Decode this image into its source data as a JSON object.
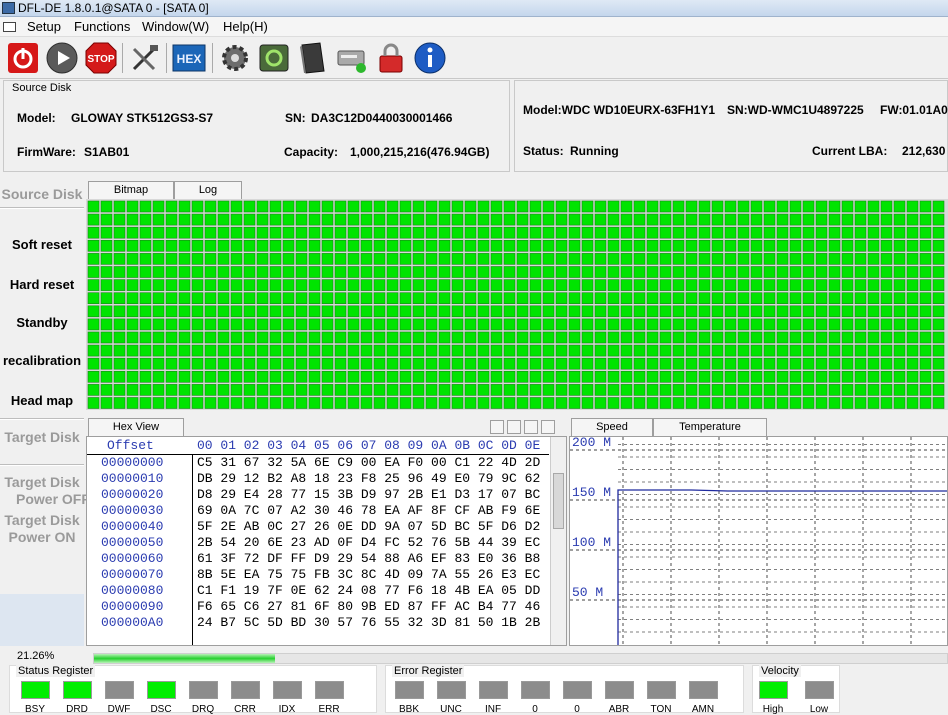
{
  "window": {
    "title": "DFL-DE 1.8.0.1@SATA 0 - [SATA 0]"
  },
  "menu": [
    "Setup",
    "Functions",
    "Window(W)",
    "Help(H)"
  ],
  "toolbar": [
    "power-button",
    "play-button",
    "stop-button",
    "tools-button",
    "hex-button",
    "settings-button",
    "refresh-button",
    "book-button",
    "disk-button",
    "lock-button",
    "info-button"
  ],
  "toolbar_hex_label": "HEX",
  "toolbar_stop_label": "STOP",
  "source": {
    "legend": "Source Disk",
    "model_label": "Model:",
    "model": "GLOWAY STK512GS3-S7",
    "sn_label": "SN:",
    "sn": "DA3C12D0440030001466",
    "firmware_label": "FirmWare:",
    "firmware": "S1AB01",
    "capacity_label": "Capacity:",
    "capacity": "1,000,215,216(476.94GB)"
  },
  "target": {
    "model": "Model:WDC WD10EURX-63FH1Y1",
    "sn": "SN:WD-WMC1U4897225",
    "fw": "FW:01.01A0",
    "status_label": "Status:",
    "status": "Running",
    "lba_label": "Current LBA:",
    "lba": "212,630"
  },
  "left_nav": {
    "source_disk": "Source Disk",
    "soft_reset": "Soft reset",
    "hard_reset": "Hard reset",
    "standby": "Standby",
    "recalibration": "recalibration",
    "head_map": "Head map",
    "target_disk": "Target Disk",
    "target_off_1": "Target Disk",
    "target_off_2": "Power OFF",
    "target_on_1": "Target Disk",
    "target_on_2": "Power ON"
  },
  "bitmap_tabs": [
    "Bitmap",
    "Log"
  ],
  "hex_tab": "Hex View",
  "hex": {
    "offset_header": "Offset",
    "col_header": "00 01 02 03 04 05 06 07 08 09 0A 0B 0C 0D 0E",
    "rows": [
      {
        "off": "00000000",
        "data": "C5 31 67 32 5A 6E C9 00 EA F0 00 C1 22 4D 2D"
      },
      {
        "off": "00000010",
        "data": "DB 29 12 B2 A8 18 23 F8 25 96 49 E0 79 9C 62"
      },
      {
        "off": "00000020",
        "data": "D8 29 E4 28 77 15 3B D9 97 2B E1 D3 17 07 BC"
      },
      {
        "off": "00000030",
        "data": "69 0A 7C 07 A2 30 46 78 EA AF 8F CF AB F9 6E"
      },
      {
        "off": "00000040",
        "data": "5F 2E AB 0C 27 26 0E DD 9A 07 5D BC 5F D6 D2"
      },
      {
        "off": "00000050",
        "data": "2B 54 20 6E 23 AD 0F D4 FC 52 76 5B 44 39 EC"
      },
      {
        "off": "00000060",
        "data": "61 3F 72 DF FF D9 29 54 88 A6 EF 83 E0 36 B8"
      },
      {
        "off": "00000070",
        "data": "8B 5E EA 75 75 FB 3C 8C 4D 09 7A 55 26 E3 EC"
      },
      {
        "off": "00000080",
        "data": "C1 F1 19 7F 0E 62 24 08 77 F6 18 4B EA 05 DD"
      },
      {
        "off": "00000090",
        "data": "F6 65 C6 27 81 6F 80 9B ED 87 FF AC B4 77 46"
      },
      {
        "off": "000000A0",
        "data": "24 B7 5C 5D BD 30 57 76 55 32 3D 81 50 1B 2B"
      }
    ]
  },
  "chart_tabs": [
    "Speed",
    "Temperature"
  ],
  "chart_data": {
    "type": "line",
    "ylabels": [
      "200 M",
      "150 M",
      "100 M",
      "50 M"
    ],
    "yticks": [
      200,
      150,
      100,
      50
    ],
    "ylim": [
      0,
      220
    ],
    "series": [
      {
        "values": [
          152,
          152,
          152,
          151,
          151,
          151,
          151,
          151,
          151,
          151
        ]
      }
    ],
    "grid": true,
    "line_color": "#1f2a9e"
  },
  "progress": {
    "text": "21.26%",
    "value": 0.2126
  },
  "status_register": {
    "legend": "Status Register",
    "leds": [
      {
        "name": "BSY",
        "on": true
      },
      {
        "name": "DRD",
        "on": true
      },
      {
        "name": "DWF",
        "on": false
      },
      {
        "name": "DSC",
        "on": true
      },
      {
        "name": "DRQ",
        "on": false
      },
      {
        "name": "CRR",
        "on": false
      },
      {
        "name": "IDX",
        "on": false
      },
      {
        "name": "ERR",
        "on": false
      }
    ]
  },
  "error_register": {
    "legend": "Error Register",
    "leds": [
      {
        "name": "BBK",
        "on": false
      },
      {
        "name": "UNC",
        "on": false
      },
      {
        "name": "INF",
        "on": false
      },
      {
        "name": "0",
        "on": false
      },
      {
        "name": "0",
        "on": false
      },
      {
        "name": "ABR",
        "on": false
      },
      {
        "name": "TON",
        "on": false
      },
      {
        "name": "AMN",
        "on": false
      }
    ]
  },
  "velocity": {
    "legend": "Velocity",
    "leds": [
      {
        "name": "High",
        "on": true
      },
      {
        "name": "Low",
        "on": false
      }
    ]
  },
  "colors": {
    "led_on": "#00ee00",
    "led_off": "#8c8c8c",
    "bitmap_cell": "#00e400",
    "hex_blue": "#2a3bb0"
  }
}
